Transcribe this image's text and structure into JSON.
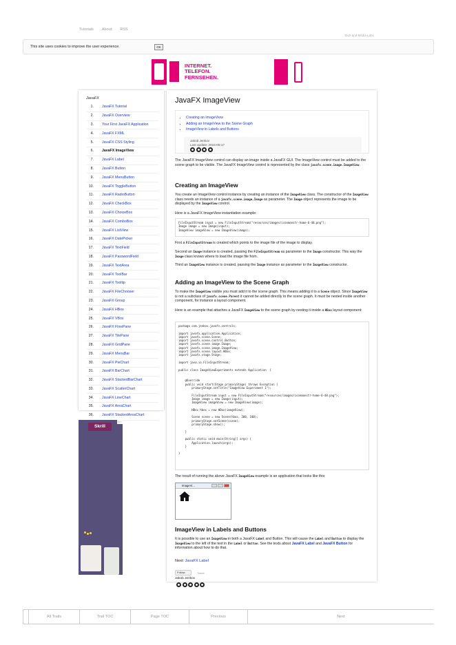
{
  "topnav": {
    "tutorials": "Tutorials",
    "about": "About",
    "rss": "RSS"
  },
  "brand": "Tech and Media Labs",
  "cookie": {
    "message": "This site uses cookies to improve the user experience.",
    "ok": "OK"
  },
  "ad": {
    "line1": "INTERNET.",
    "line2": "TELEFON.",
    "line3": "FERNSEHEN.",
    "brand_color": "#e20074"
  },
  "sidebar": {
    "title": "JavaFX",
    "items": [
      {
        "num": "1.",
        "label": "JavaFX Tutorial"
      },
      {
        "num": "2.",
        "label": "JavaFX Overview"
      },
      {
        "num": "3.",
        "label": "Your First JavaFX Application"
      },
      {
        "num": "4.",
        "label": "JavaFX FXML"
      },
      {
        "num": "5.",
        "label": "JavaFX CSS Styling"
      },
      {
        "num": "6.",
        "label": "JavaFX ImageView"
      },
      {
        "num": "7.",
        "label": "JavaFX Label"
      },
      {
        "num": "8.",
        "label": "JavaFX Button"
      },
      {
        "num": "9.",
        "label": "JavaFX MenuButton"
      },
      {
        "num": "10.",
        "label": "JavaFX ToggleButton"
      },
      {
        "num": "11.",
        "label": "JavaFX RadioButton"
      },
      {
        "num": "12.",
        "label": "JavaFX CheckBox"
      },
      {
        "num": "13.",
        "label": "JavaFX ChoiceBox"
      },
      {
        "num": "14.",
        "label": "JavaFX ComboBox"
      },
      {
        "num": "15.",
        "label": "JavaFX ListView"
      },
      {
        "num": "16.",
        "label": "JavaFX DatePicker"
      },
      {
        "num": "17.",
        "label": "JavaFX TextField"
      },
      {
        "num": "18.",
        "label": "JavaFX PasswordField"
      },
      {
        "num": "19.",
        "label": "JavaFX TextArea"
      },
      {
        "num": "20.",
        "label": "JavaFX ToolBar"
      },
      {
        "num": "21.",
        "label": "JavaFX Tooltip"
      },
      {
        "num": "22.",
        "label": "JavaFX FileChooser"
      },
      {
        "num": "23.",
        "label": "JavaFX Group"
      },
      {
        "num": "24.",
        "label": "JavaFX HBox"
      },
      {
        "num": "25.",
        "label": "JavaFX VBox"
      },
      {
        "num": "26.",
        "label": "JavaFX FlowPane"
      },
      {
        "num": "27.",
        "label": "JavaFX TilePane"
      },
      {
        "num": "28.",
        "label": "JavaFX GridPane"
      },
      {
        "num": "29.",
        "label": "JavaFX MenuBar"
      },
      {
        "num": "30.",
        "label": "JavaFX PieChart"
      },
      {
        "num": "31.",
        "label": "JavaFX BarChart"
      },
      {
        "num": "32.",
        "label": "JavaFX StackedBarChart"
      },
      {
        "num": "33.",
        "label": "JavaFX ScatterChart"
      },
      {
        "num": "34.",
        "label": "JavaFX LineChart"
      },
      {
        "num": "35.",
        "label": "JavaFX AreaChart"
      },
      {
        "num": "36.",
        "label": "JavaFX StackedAreaChart"
      }
    ]
  },
  "skrill_ad": {
    "brand": "Skrill",
    "choices": "▷×"
  },
  "article": {
    "title": "JavaFX ImageView",
    "toc": [
      "Creating an ImageView",
      "Adding an ImageView to the Scene Graph",
      "ImageView in Labels and Buttons"
    ],
    "author": "Jakob Jenkov",
    "last_update": "Last update: 2016-05-17",
    "intro_a": "The JavaFX ImageView control can display an image inside a JavaFX GUI. The ImageView control must be added to the scene graph to be visible. The JavaFX ImageView control is represented by the class ",
    "intro_code": "javafx.scene.image.ImageView",
    "intro_b": ".",
    "h_create": "Creating an ImageView",
    "create_p1a": "You create an ImageView control instance by creating an instance of the ",
    "create_p1_code1": "ImageView",
    "create_p1b": " class. The constructor of the ",
    "create_p1_code2": "ImageView",
    "create_p1c": " class needs an instance of a ",
    "create_p1_code3": "javafx.scene.image.Image",
    "create_p1d": " as parameter. The ",
    "create_p1_code4": "Image",
    "create_p1e": " object represents the image to be displayed by the ",
    "create_p1_code5": "ImageView",
    "create_p1f": " control.",
    "create_p2": "Here is a JavaFX ImageView instantiation example:",
    "code1": "FileInputStream input = new FileInputStream(\"resources/images/iconmonstr-home-6-48.png\");\nImage image = new Image(input);\nImageView imageView = new ImageView(image);",
    "first_a": "First a ",
    "first_code": "FileInputStream",
    "first_b": " is created which points to the image file of the image to display.",
    "second_a": "Second an ",
    "second_code1": "Image",
    "second_b": " instance is created, passing the ",
    "second_code2": "FileInputStream",
    "second_c": " as parameter to the ",
    "second_code3": "Image",
    "second_d": " constructor. This way the ",
    "second_code4": "Image",
    "second_e": " class knows where to load the image file from.",
    "third_a": "Third an ",
    "third_code1": "ImageView",
    "third_b": " instance is created, passing the ",
    "third_code2": "Image",
    "third_c": " instance as parameter to the ",
    "third_code3": "ImageView",
    "third_d": " constructor.",
    "h_add": "Adding an ImageView to the Scene Graph",
    "add_p1a": "To make the ",
    "add_p1_code1": "ImageView",
    "add_p1b": " visible you must add it to the scene graph. This means adding it to a ",
    "add_p1_code2": "Scene",
    "add_p1c": " object. Since ",
    "add_p1_code3": "ImageView",
    "add_p1d": " is not a subclass of ",
    "add_p1_code4": "javafx.scene.Parent",
    "add_p1e": " it cannot be added directly to the scene graph. It must be nested inside another component, for instance a layout component.",
    "add_p2a": "Here is an example that attaches a JavaFX ",
    "add_p2_code1": "ImageView",
    "add_p2b": " to the scene graph by nesting it inside a ",
    "add_p2_code2": "HBox",
    "add_p2c": " layout component:",
    "code2": "package com.jenkov.javafx.controls;\n\nimport javafx.application.Application;\nimport javafx.scene.Scene;\nimport javafx.scene.control.Button;\nimport javafx.scene.image.Image;\nimport javafx.scene.image.ImageView;\nimport javafx.scene.layout.HBox;\nimport javafx.stage.Stage;\n\nimport java.io.FileInputStream;\n\npublic class ImageViewExperiments extends Application  {\n\n\n    @Override\n    public void start(Stage primaryStage) throws Exception {\n        primaryStage.setTitle(\"ImageView Experiment 1\");\n\n        FileInputStream input = new FileInputStream(\"resources/images/iconmonstr-home-6-48.png\");\n        Image image = new Image(input);\n        ImageView imageView = new ImageView(image);\n\n        HBox hbox = new HBox(imageView);\n\n        Scene scene = new Scene(hbox, 200, 100);\n        primaryStage.setScene(scene);\n        primaryStage.show();\n\n    }\n\n    public static void main(String[] args) {\n        Application.launch(args);\n    }\n\n}",
    "result_a": "The result of running the above JavaFX ",
    "result_code": "ImageView",
    "result_b": " example is an application that looks like this:",
    "demo_title": "ImageVi...",
    "h_labels": "ImageView in Labels and Buttons",
    "labels_a": "It is possible to use an ",
    "labels_code1": "ImageView",
    "labels_b": " in both a JavaFX ",
    "labels_code2": "Label",
    "labels_c": " and Button. This will cause the ",
    "labels_code3": "Label",
    "labels_d": " and ",
    "labels_code4": "Button",
    "labels_e": " to display the ",
    "labels_code5": "ImageView",
    "labels_f": " to the left of the text in the ",
    "labels_code6": "Label",
    "labels_g": " or ",
    "labels_code7": "Button",
    "labels_h": ". See the texts about ",
    "labels_link1": "JavaFX Label",
    "labels_i": " and ",
    "labels_link2": "JavaFX Button",
    "labels_j": " for information about how to do that.",
    "next_label": "Next: ",
    "next_link": "JavaFX Label",
    "share_fb": "Follow",
    "share_tw": "Tweet",
    "footer_author": "Jakob Jenkov"
  },
  "bottomnav": [
    "All Trails",
    "Trail TOC",
    "Page TOC",
    "Previous",
    "Next"
  ]
}
